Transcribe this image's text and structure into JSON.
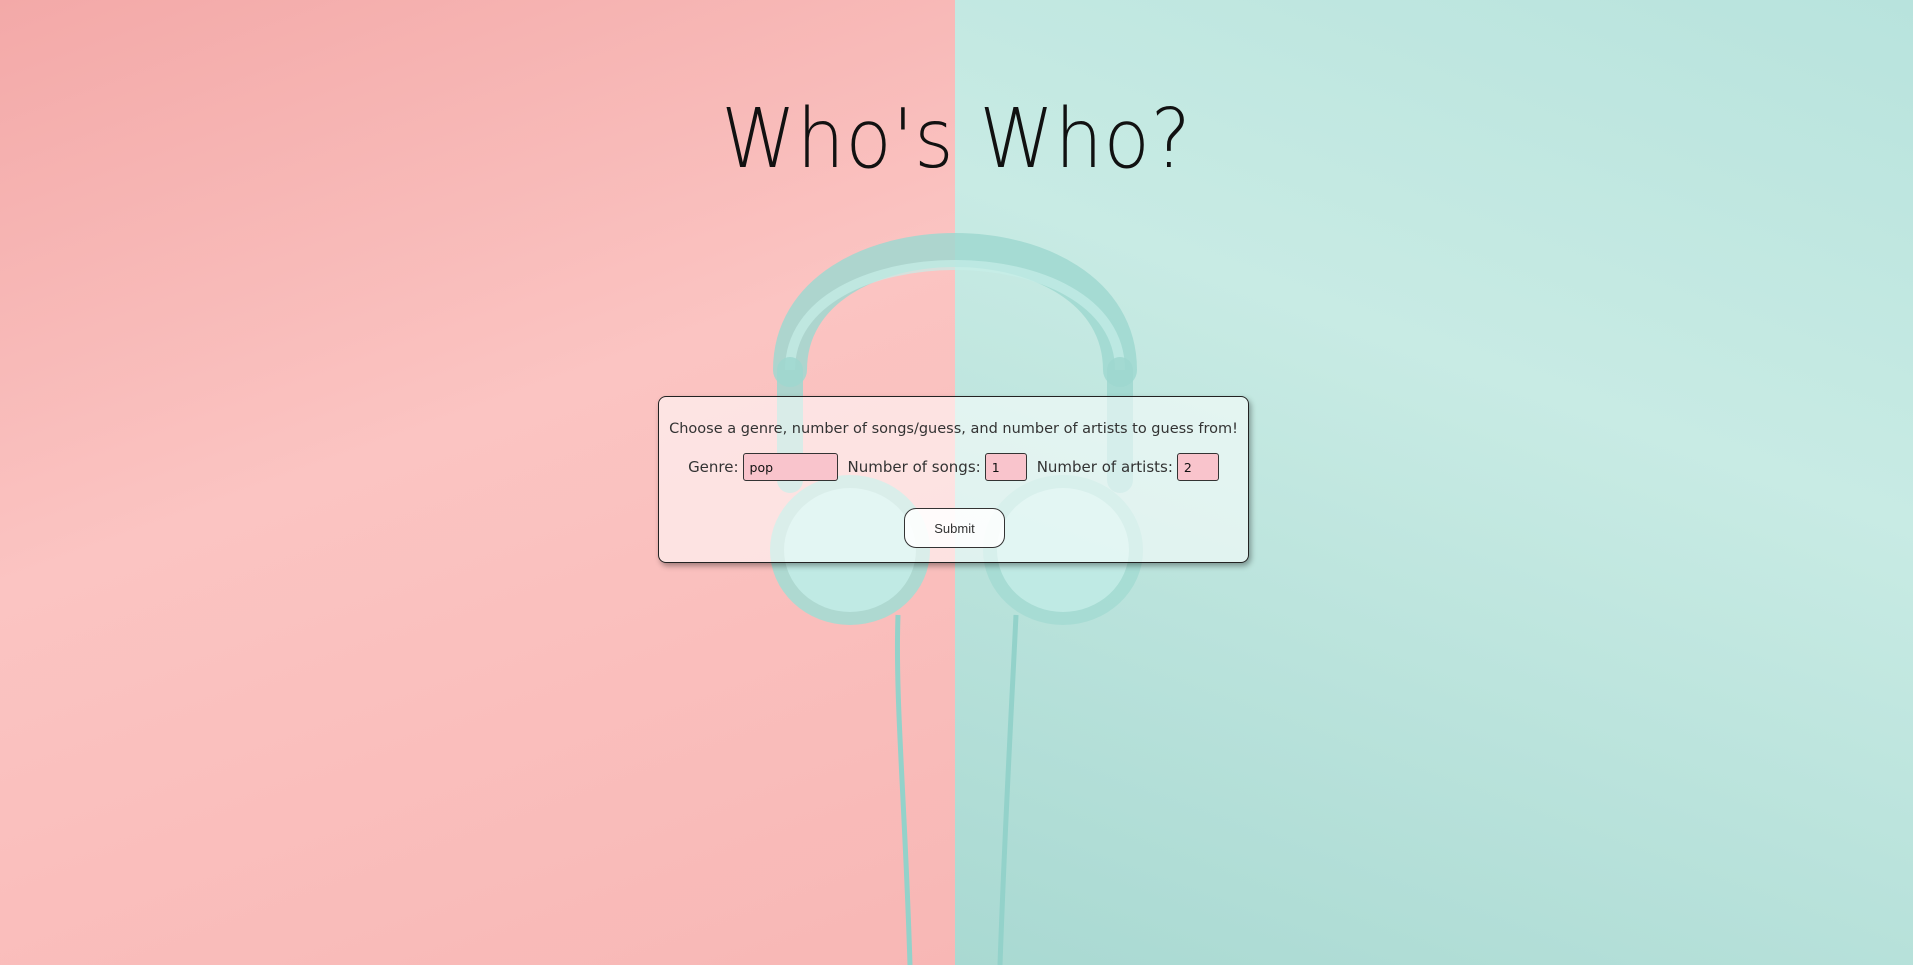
{
  "header": {
    "title": "Who's Who?"
  },
  "form": {
    "prompt": "Choose a genre, number of songs/guess, and number of artists to guess from!",
    "genre_label": "Genre:",
    "genre_value": "pop",
    "songs_label": "Number of songs:",
    "songs_value": "1",
    "artists_label": "Number of artists:",
    "artists_value": "2",
    "submit_label": "Submit"
  },
  "colors": {
    "background_left": "#f8b7b5",
    "background_right": "#b8e3dd",
    "input_fill": "#f9c4cc",
    "headphones": "#a8dcd5"
  },
  "icons": {
    "background": "headphones-illustration"
  }
}
